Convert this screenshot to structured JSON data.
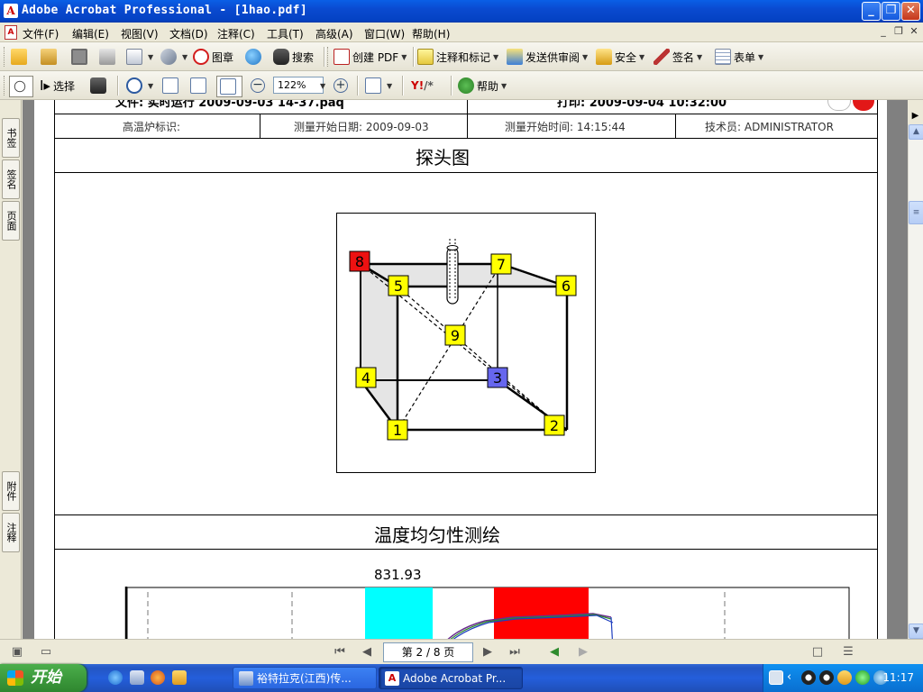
{
  "window": {
    "title": "Adobe Acrobat Professional - [1hao.pdf]",
    "app_icon": "acrobat-icon"
  },
  "menubar": {
    "items": [
      "文件(F)",
      "编辑(E)",
      "视图(V)",
      "文档(D)",
      "注释(C)",
      "工具(T)",
      "高级(A)",
      "窗口(W)",
      "帮助(H)"
    ]
  },
  "toolbar1": {
    "stamp": "图章",
    "search": "搜索",
    "create_pdf": "创建 PDF",
    "comment": "注释和标记",
    "send_review": "发送供审阅",
    "security": "安全",
    "sign": "签名",
    "forms": "表单"
  },
  "toolbar2": {
    "select": "选择",
    "zoom": "122%",
    "help": "帮助"
  },
  "leftpanel": {
    "tabs": [
      "书签",
      "签名",
      "页面",
      "附件",
      "注释"
    ]
  },
  "document": {
    "partial_top_left": "文件: 实时运行 2009-09-03 14-37.paq",
    "partial_top_right": "打印: 2009-09-04 10:32:00",
    "info_row": {
      "furnace_id_label": "高温炉标识:",
      "start_date": "测量开始日期: 2009-09-03",
      "start_time": "测量开始时间: 14:15:44",
      "technician": "技术员: ADMINISTRATOR"
    },
    "probe_section_title": "探头图",
    "probes": [
      {
        "label": "1",
        "color": "#ffff00"
      },
      {
        "label": "2",
        "color": "#ffff00"
      },
      {
        "label": "3",
        "color": "#6666ee"
      },
      {
        "label": "4",
        "color": "#ffff00"
      },
      {
        "label": "5",
        "color": "#ffff00"
      },
      {
        "label": "6",
        "color": "#ffff00"
      },
      {
        "label": "7",
        "color": "#ffff00"
      },
      {
        "label": "8",
        "color": "#ee1111"
      },
      {
        "label": "9",
        "color": "#ffff00"
      }
    ],
    "uniformity_section_title": "温度均匀性测绘",
    "chart_value_label": "831.93"
  },
  "statusbar": {
    "page_indicator": "第 2 / 8 页"
  },
  "taskbar": {
    "start": "开始",
    "tasks": [
      {
        "label": "裕特拉克(江西)传...",
        "active": false
      },
      {
        "label": "Adobe Acrobat Pr...",
        "active": true
      }
    ],
    "clock": "11:17"
  }
}
